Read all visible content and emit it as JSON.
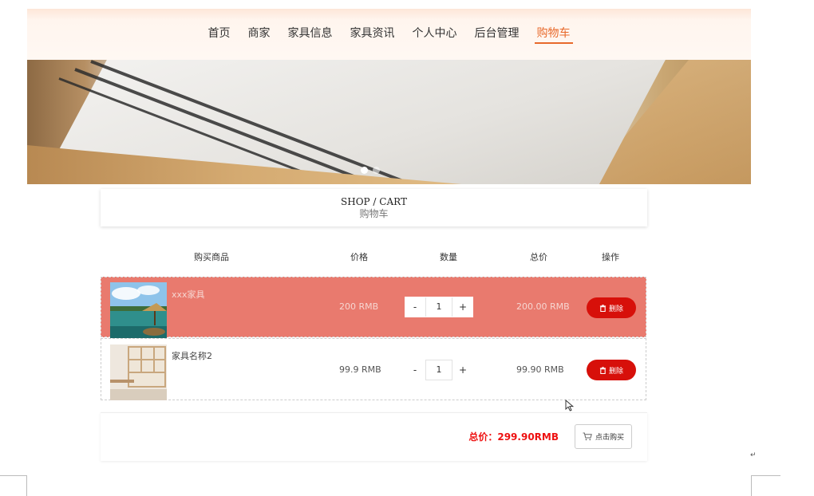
{
  "nav": {
    "items": [
      {
        "label": "首页",
        "active": false
      },
      {
        "label": "商家",
        "active": false
      },
      {
        "label": "家具信息",
        "active": false
      },
      {
        "label": "家具资讯",
        "active": false
      },
      {
        "label": "个人中心",
        "active": false
      },
      {
        "label": "后台管理",
        "active": false
      },
      {
        "label": "购物车",
        "active": true
      }
    ],
    "accent_color": "#e8692b"
  },
  "banner": {
    "slide_count": 2,
    "active_slide": 1
  },
  "section_title": {
    "en": "SHOP / CART",
    "zh": "购物车"
  },
  "cart_table": {
    "headers": {
      "product": "购买商品",
      "price": "价格",
      "quantity": "数量",
      "subtotal": "总价",
      "action": "操作"
    },
    "rows": [
      {
        "name": "xxx家具",
        "price": "200 RMB",
        "quantity": "1",
        "subtotal": "200.00 RMB",
        "highlighted": true,
        "delete_label": "删除",
        "minus_label": "-",
        "plus_label": "+",
        "thumb": "beach-hut-photo"
      },
      {
        "name": "家具名称2",
        "price": "99.9 RMB",
        "quantity": "1",
        "subtotal": "99.90 RMB",
        "highlighted": false,
        "delete_label": "删除",
        "minus_label": "-",
        "plus_label": "+",
        "thumb": "bookshelf-photo"
      }
    ],
    "highlight_color": "#e97a6e",
    "delete_color": "#d7100a"
  },
  "footer": {
    "total_label": "总价：299.90RMB",
    "buy_label": "点击购买",
    "total_color": "#ee1111"
  },
  "icons": {
    "trash": "trash-icon",
    "cart": "cart-icon",
    "cursor": "mouse-cursor-icon",
    "paragraph": "paragraph-mark-icon"
  },
  "para_mark": "↵"
}
